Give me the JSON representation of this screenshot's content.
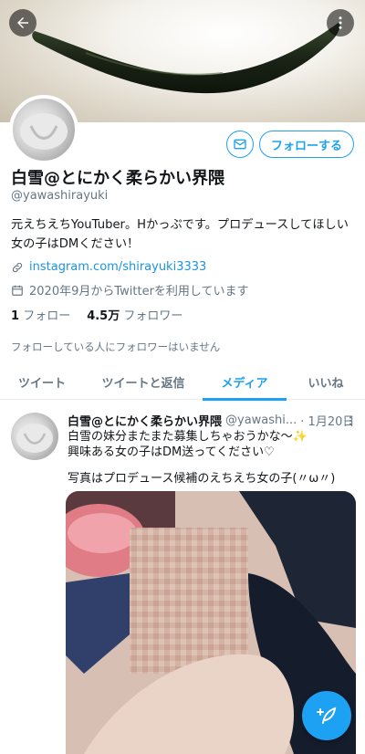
{
  "profile": {
    "display_name": "白雪@とにかく柔らかい界隈",
    "handle": "@yawashirayuki",
    "bio": "元えちえちYouTuber。Hかっぷです。プロデュースしてほしい女の子はDMください！",
    "link": "instagram.com/shirayuki3333",
    "joined": "2020年9月からTwitterを利用しています",
    "following_count": "1",
    "following_label": "フォロー",
    "followers_count": "4.5万",
    "followers_label": "フォロワー",
    "known_followers": "フォローしている人にフォロワーはいません",
    "follow_button": "フォローする"
  },
  "icons": {
    "back": "back-arrow-icon",
    "more": "more-vertical-icon",
    "mail": "mail-icon",
    "link": "link-icon",
    "calendar": "calendar-icon",
    "caret": "caret-down-icon",
    "compose": "compose-tweet-icon"
  },
  "tabs": [
    {
      "label": "ツイート"
    },
    {
      "label": "ツイートと返信"
    },
    {
      "label": "メディア"
    },
    {
      "label": "いいね"
    }
  ],
  "active_tab": "メディア",
  "tweet": {
    "name": "白雪@とにかく柔らかい界隈",
    "handle": "@yawashi...",
    "date": "· 1月20日",
    "line1": "白雪の妹分またまた募集しちゃおうかな〜✨",
    "line2": "興味ある女の子はDM送ってください♡",
    "line3": "写真はプロデュース候補のえちえち女の子(〃ω〃)"
  },
  "colors": {
    "accent": "#1da1f2",
    "text": "#14171a",
    "secondary": "#657786"
  }
}
